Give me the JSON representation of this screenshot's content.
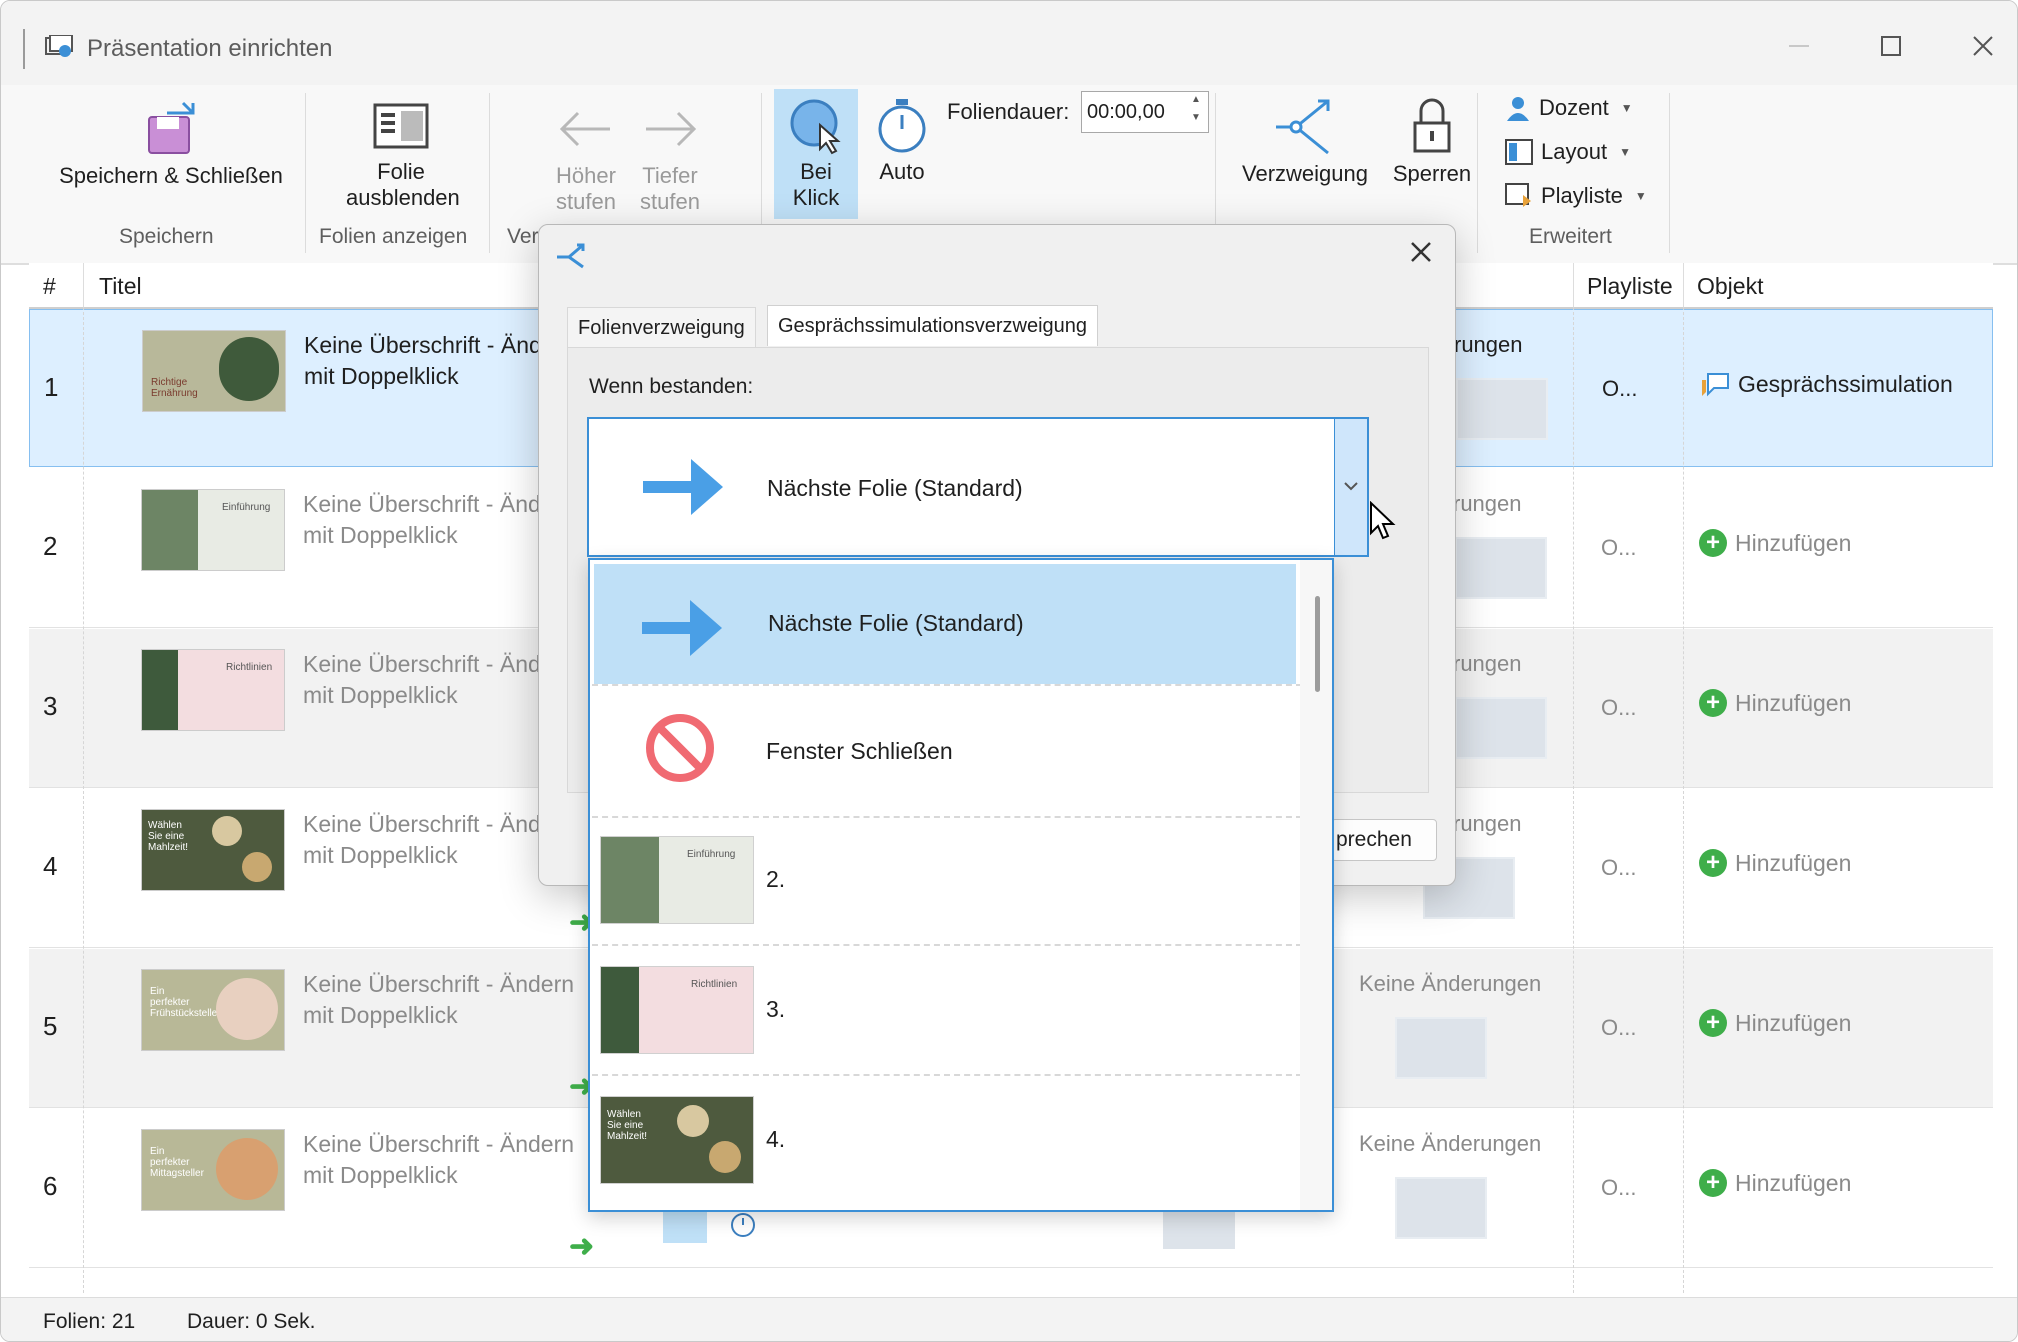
{
  "window": {
    "title": "Präsentation einrichten"
  },
  "ribbon": {
    "save_close": "Speichern & Schließen",
    "group_save": "Speichern",
    "hide_slide": "Folie ausblenden",
    "group_show": "Folien anzeigen",
    "higher": "Höher stufen",
    "lower": "Tiefer stufen",
    "group_cut": "Ver",
    "on_click": "Bei Klick",
    "auto": "Auto",
    "duration_label": "Foliendauer:",
    "duration_value": "00:00,00",
    "branch": "Verzweigung",
    "lock": "Sperren",
    "presenter": "Dozent",
    "layout": "Layout",
    "playlist": "Playliste",
    "group_advanced": "Erweitert"
  },
  "table": {
    "headers": {
      "num": "#",
      "title": "Titel",
      "playlist": "Playliste",
      "object": "Objekt"
    },
    "rows": [
      {
        "num": "1",
        "title1": "Keine Überschrift - Änd",
        "title2": "mit Doppelklick",
        "changes": "rungen",
        "playlist": "O...",
        "object": "Gesprächssimulation"
      },
      {
        "num": "2",
        "title1": "Keine Überschrift - Änd",
        "title2": "mit Doppelklick",
        "changes": "rungen",
        "playlist": "O...",
        "object": "Hinzufügen"
      },
      {
        "num": "3",
        "title1": "Keine Überschrift - Änd",
        "title2": "mit Doppelklick",
        "changes": "rungen",
        "playlist": "O...",
        "object": "Hinzufügen"
      },
      {
        "num": "4",
        "title1": "Keine Überschrift - Änd",
        "title2": "mit Doppelklick",
        "changes": "rungen",
        "playlist": "O...",
        "object": "Hinzufügen"
      },
      {
        "num": "5",
        "title1": "Keine Überschrift - Ändern",
        "title2": "mit Doppelklick",
        "changes": "Keine Änderungen",
        "playlist": "O...",
        "object": "Hinzufügen"
      },
      {
        "num": "6",
        "title1": "Keine Überschrift - Ändern",
        "title2": "mit Doppelklick",
        "changes": "Keine Änderungen",
        "playlist": "O...",
        "object": "Hinzufügen"
      }
    ]
  },
  "thumbs": {
    "r1": "Richtige Ernährung",
    "r2": "Einführung",
    "r3": "Richtlinien",
    "r4": "Wählen Sie eine Mahlzeit!",
    "r5": "Ein perfekter Frühstücksteller",
    "r6": "Ein perfekter Mittagsteller"
  },
  "status": {
    "slides": "Folien: 21",
    "duration": "Dauer:  0 Sek."
  },
  "dialog": {
    "tab1": "Folienverzweigung",
    "tab2": "Gesprächssimulationsverzweigung",
    "when_passed": "Wenn bestanden:",
    "selected": "Nächste Folie (Standard)",
    "button_partial": "prechen",
    "options": [
      "Nächste Folie (Standard)",
      "Fenster Schließen",
      "2.",
      "3.",
      "4."
    ]
  },
  "colors": {
    "accent": "#3b8fd6",
    "selection": "#bfe0f7",
    "green": "#3fae4a",
    "red": "#f06a72",
    "arrow_blue": "#4a9fe6"
  }
}
